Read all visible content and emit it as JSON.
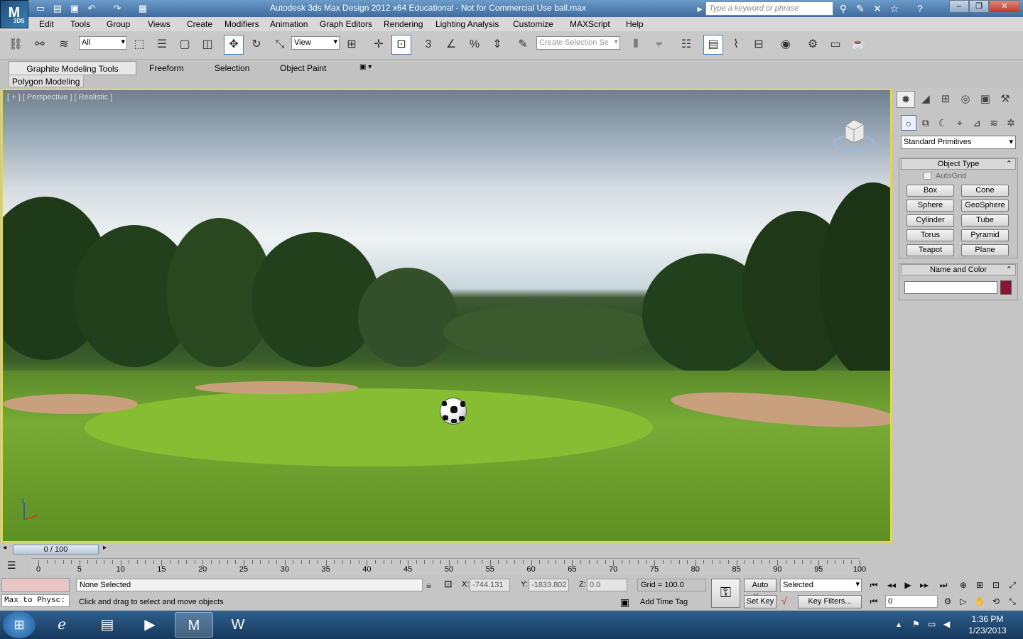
{
  "app": {
    "title": "Autodesk 3ds Max Design 2012 x64   Educational - Not for Commercial Use    ball.max",
    "logo_label": "3DS"
  },
  "search": {
    "placeholder": "Type a keyword or phrase"
  },
  "menu": [
    "Edit",
    "Tools",
    "Group",
    "Views",
    "Create",
    "Modifiers",
    "Animation",
    "Graph Editors",
    "Rendering",
    "Lighting Analysis",
    "Customize",
    "MAXScript",
    "Help"
  ],
  "toolbar": {
    "filter": "All",
    "ref_coord": "View",
    "selection_set": "Create Selection Se"
  },
  "ribbon": {
    "tabs": [
      "Graphite Modeling Tools",
      "Freeform",
      "Selection",
      "Object Paint"
    ],
    "panel": "Polygon Modeling"
  },
  "viewport": {
    "label": "[ + ] [ Perspective ] [ Realistic ]"
  },
  "command_panel": {
    "dropdown": "Standard Primitives",
    "object_type_title": "Object Type",
    "autogrid": "AutoGrid",
    "buttons": [
      "Box",
      "Cone",
      "Sphere",
      "GeoSphere",
      "Cylinder",
      "Tube",
      "Torus",
      "Pyramid",
      "Teapot",
      "Plane"
    ],
    "name_color_title": "Name and Color",
    "object_color": "#8b1538"
  },
  "timeline": {
    "frame": "0 / 100",
    "labels": [
      "0",
      "5",
      "10",
      "15",
      "20",
      "25",
      "30",
      "35",
      "40",
      "45",
      "50",
      "55",
      "60",
      "65",
      "70",
      "75",
      "80",
      "85",
      "90",
      "95",
      "100"
    ]
  },
  "status": {
    "script_listener": "Max to Physc:",
    "selection": "None Selected",
    "prompt": "Click and drag to select and move objects",
    "x_label": "X:",
    "x": "-744.131",
    "y_label": "Y:",
    "y": "-1833.802",
    "z_label": "Z:",
    "z": "0.0",
    "grid": "Grid = 100.0",
    "add_time_tag": "Add Time Tag",
    "auto_key": "Auto Key",
    "set_key": "Set Key",
    "key_mode": "Selected",
    "key_filters": "Key Filters...",
    "current_frame": "0"
  },
  "taskbar": {
    "time": "1:36 PM",
    "date": "1/23/2013"
  }
}
